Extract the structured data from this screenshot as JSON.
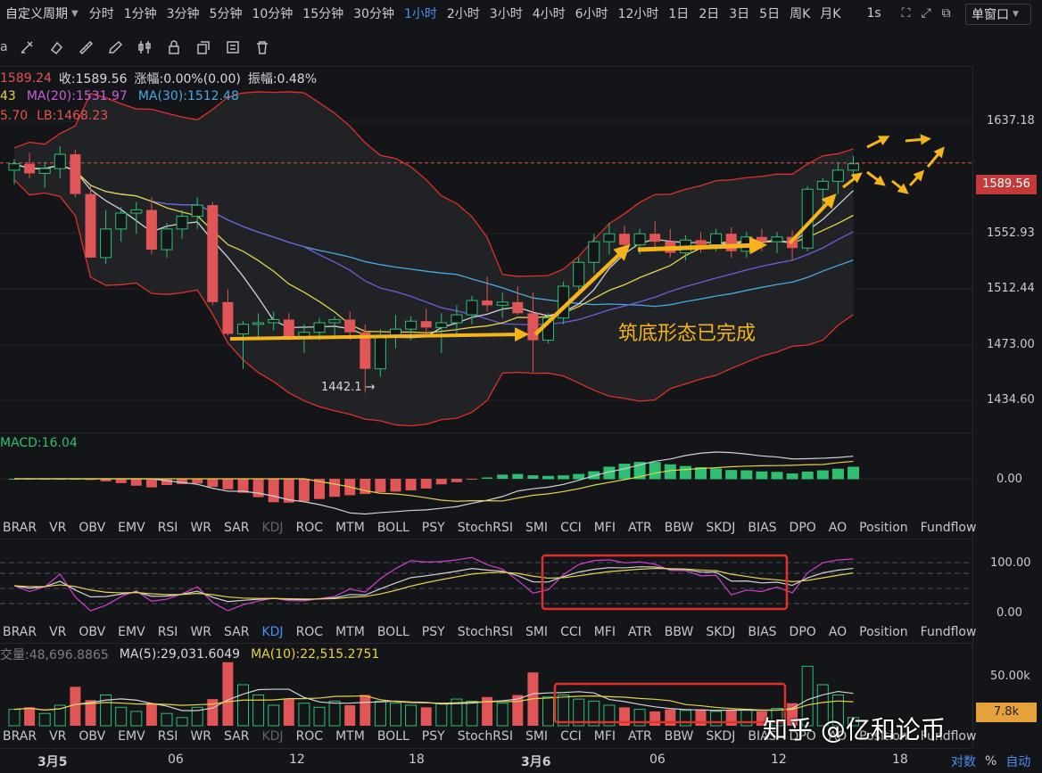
{
  "topbar": {
    "custom_label": "自定义周期",
    "periods": [
      "分时",
      "1分钟",
      "3分钟",
      "5分钟",
      "10分钟",
      "15分钟",
      "30分钟",
      "1小时",
      "2小时",
      "3小时",
      "4小时",
      "6小时",
      "12小时",
      "1日",
      "2日",
      "3日",
      "5日",
      "周K",
      "月K"
    ],
    "active_period": "1小时",
    "seconds": "1s",
    "window_select": "单窗口"
  },
  "main_legend": {
    "line1": [
      {
        "text": "1589.24",
        "color": "#e05555"
      },
      {
        "text": "收:1589.56",
        "color": "#d7d9de"
      },
      {
        "text": "涨幅:0.00%(0.00)",
        "color": "#d7d9de"
      },
      {
        "text": "振幅:0.48%",
        "color": "#d7d9de"
      }
    ],
    "line2": [
      {
        "text": "43",
        "color": "#e6d24a"
      },
      {
        "text": "MA(20):1531.97",
        "color": "#c85fd6"
      },
      {
        "text": "MA(30):1512.48",
        "color": "#4aa8e0"
      }
    ],
    "line3": [
      {
        "text": "5.70",
        "color": "#e05555"
      },
      {
        "text": "LB:1468.23",
        "color": "#e05555"
      }
    ]
  },
  "y_axis_main": [
    "1637.18",
    "1552.93",
    "1512.44",
    "1473.00",
    "1434.60"
  ],
  "current_price": "1589.56",
  "low_marker": "1442.1",
  "annotation": "筑底形态已完成",
  "macd": {
    "label": "MACD:16.04",
    "zero": "0.00"
  },
  "indicator_tabs": [
    "BRAR",
    "VR",
    "OBV",
    "EMV",
    "RSI",
    "WR",
    "SAR",
    "KDJ",
    "ROC",
    "MTM",
    "BOLL",
    "PSY",
    "StochRSI",
    "SMI",
    "CCI",
    "MFI",
    "ATR",
    "BBW",
    "SKDJ",
    "BIAS",
    "DPO",
    "AO",
    "Position",
    "Fundflow"
  ],
  "kdj_axis": [
    "100.00",
    "0.00"
  ],
  "volume": {
    "legend": [
      {
        "text": "交量:48,696.8865",
        "color": "#7a7e87"
      },
      {
        "text": "MA(5):29,031.6049",
        "color": "#d7d9de"
      },
      {
        "text": "MA(10):22,515.2751",
        "color": "#e6d24a"
      }
    ],
    "axis": "50.00k",
    "current": "7.8k"
  },
  "x_axis": [
    "3月5",
    "06",
    "12",
    "18",
    "3月6",
    "06",
    "12",
    "18"
  ],
  "bottom_right": {
    "log": "对数",
    "pct": "%",
    "auto": "自动"
  },
  "watermark": "知乎 @亿和论币",
  "colors": {
    "up": "#2fbf71",
    "down": "#e05555",
    "accent": "#4b8cf2",
    "arrow": "#f5b41a",
    "highlight": "#e0302a"
  },
  "chart_data": {
    "type": "candlestick",
    "ylim": [
      1420,
      1650
    ],
    "candles": [
      [
        1585,
        1592,
        1576,
        1589
      ],
      [
        1589,
        1596,
        1580,
        1583
      ],
      [
        1583,
        1590,
        1574,
        1586
      ],
      [
        1586,
        1600,
        1580,
        1595
      ],
      [
        1595,
        1598,
        1568,
        1570
      ],
      [
        1570,
        1575,
        1530,
        1530
      ],
      [
        1530,
        1560,
        1526,
        1548
      ],
      [
        1548,
        1562,
        1540,
        1558
      ],
      [
        1558,
        1565,
        1545,
        1560
      ],
      [
        1560,
        1568,
        1532,
        1535
      ],
      [
        1535,
        1552,
        1530,
        1548
      ],
      [
        1548,
        1560,
        1542,
        1556
      ],
      [
        1556,
        1568,
        1548,
        1563
      ],
      [
        1563,
        1565,
        1500,
        1502
      ],
      [
        1502,
        1510,
        1481,
        1482
      ],
      [
        1482,
        1490,
        1460,
        1488
      ],
      [
        1488,
        1495,
        1480,
        1489
      ],
      [
        1489,
        1496,
        1484,
        1491
      ],
      [
        1491,
        1495,
        1478,
        1480
      ],
      [
        1480,
        1488,
        1470,
        1483
      ],
      [
        1483,
        1492,
        1478,
        1489
      ],
      [
        1489,
        1493,
        1480,
        1491
      ],
      [
        1491,
        1496,
        1478,
        1483
      ],
      [
        1483,
        1488,
        1445,
        1460
      ],
      [
        1460,
        1485,
        1455,
        1480
      ],
      [
        1480,
        1494,
        1473,
        1485
      ],
      [
        1485,
        1493,
        1478,
        1490
      ],
      [
        1490,
        1498,
        1480,
        1486
      ],
      [
        1486,
        1495,
        1470,
        1489
      ],
      [
        1489,
        1500,
        1480,
        1494
      ],
      [
        1494,
        1506,
        1488,
        1503
      ],
      [
        1503,
        1518,
        1496,
        1500
      ],
      [
        1500,
        1508,
        1492,
        1502
      ],
      [
        1502,
        1512,
        1494,
        1495
      ],
      [
        1495,
        1508,
        1458,
        1478
      ],
      [
        1478,
        1495,
        1476,
        1492
      ],
      [
        1492,
        1515,
        1488,
        1512
      ],
      [
        1512,
        1530,
        1506,
        1527
      ],
      [
        1527,
        1545,
        1520,
        1540
      ],
      [
        1540,
        1552,
        1532,
        1545
      ],
      [
        1545,
        1550,
        1536,
        1538
      ],
      [
        1538,
        1548,
        1532,
        1545
      ],
      [
        1545,
        1553,
        1536,
        1540
      ],
      [
        1540,
        1548,
        1530,
        1533
      ],
      [
        1533,
        1544,
        1528,
        1541
      ],
      [
        1541,
        1546,
        1533,
        1538
      ],
      [
        1538,
        1548,
        1534,
        1545
      ],
      [
        1545,
        1549,
        1530,
        1534
      ],
      [
        1534,
        1546,
        1530,
        1543
      ],
      [
        1543,
        1548,
        1534,
        1540
      ],
      [
        1540,
        1546,
        1533,
        1543
      ],
      [
        1543,
        1547,
        1528,
        1536
      ],
      [
        1536,
        1575,
        1534,
        1573
      ],
      [
        1573,
        1580,
        1562,
        1578
      ],
      [
        1578,
        1590,
        1570,
        1585
      ],
      [
        1585,
        1594,
        1580,
        1589
      ]
    ],
    "volume": [
      16,
      18,
      12,
      20,
      38,
      25,
      30,
      18,
      14,
      22,
      12,
      8,
      18,
      26,
      62,
      40,
      30,
      20,
      26,
      22,
      18,
      24,
      20,
      30,
      24,
      22,
      20,
      18,
      22,
      26,
      24,
      28,
      22,
      30,
      52,
      28,
      30,
      26,
      24,
      20,
      18,
      16,
      14,
      16,
      15,
      16,
      14,
      15,
      16,
      14,
      17,
      22,
      58,
      40,
      30,
      8
    ]
  }
}
